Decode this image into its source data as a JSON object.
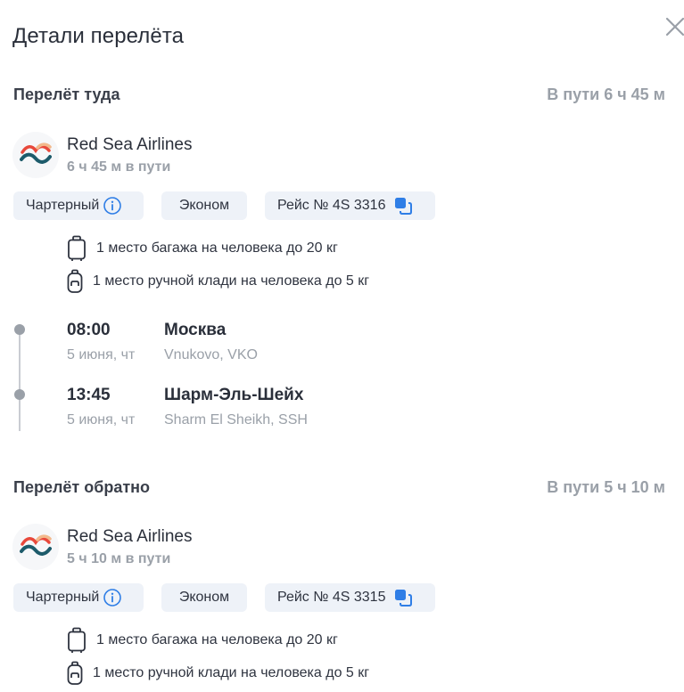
{
  "dialog": {
    "title": "Детали перелёта"
  },
  "outbound": {
    "title": "Перелёт туда",
    "duration": "В пути 6 ч 45 м",
    "airline": "Red Sea Airlines",
    "airline_time": "6 ч 45 м в пути",
    "chips": {
      "charter": "Чартерный",
      "class": "Эконом",
      "flight": "Рейс № 4S 3316"
    },
    "baggage": "1 место багажа на человека до 20 кг",
    "carry_on": "1 место ручной клади на человека до 5 кг",
    "departure": {
      "time": "08:00",
      "date": "5 июня, чт",
      "city": "Москва",
      "airport": "Vnukovo, VKO"
    },
    "arrival": {
      "time": "13:45",
      "date": "5 июня, чт",
      "city": "Шарм-Эль-Шейх",
      "airport": "Sharm El Sheikh, SSH"
    }
  },
  "return": {
    "title": "Перелёт обратно",
    "duration": "В пути 5 ч 10 м",
    "airline": "Red Sea Airlines",
    "airline_time": "5 ч 10 м в пути",
    "chips": {
      "charter": "Чартерный",
      "class": "Эконом",
      "flight": "Рейс № 4S 3315"
    },
    "baggage": "1 место багажа на человека до 20 кг",
    "carry_on": "1 место ручной клади на человека до 5 кг"
  },
  "colors": {
    "accent_blue": "#2f7ee6",
    "muted": "#9aa0a8",
    "chip_bg": "#eef2f8",
    "logo_teal": "#1d5b6b",
    "logo_red": "#e8483b",
    "logo_peach": "#f2b98c"
  },
  "icons": {
    "close": "close-icon",
    "info": "info-icon",
    "copy": "copy-icon",
    "suitcase": "suitcase-icon",
    "backpack": "backpack-icon",
    "airline_logo": "airline-logo-icon"
  }
}
